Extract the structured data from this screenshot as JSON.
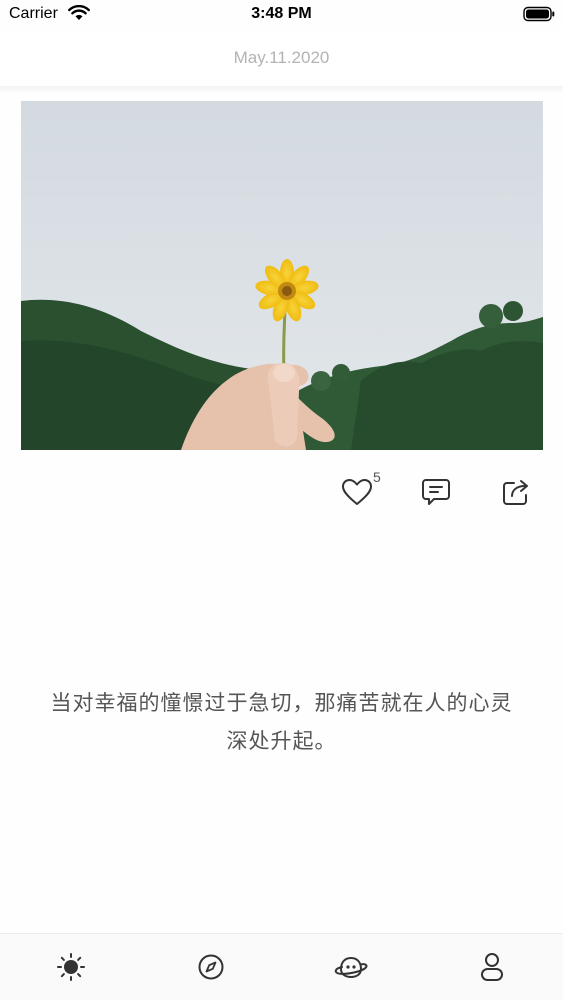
{
  "status_bar": {
    "carrier": "Carrier",
    "time": "3:48 PM",
    "icons": [
      "wifi-icon",
      "battery-icon"
    ]
  },
  "header": {
    "date": "May.11.2020"
  },
  "post": {
    "image": {
      "subject": "hand-holding-yellow-flower"
    },
    "actions": {
      "like_count": "5",
      "icons": [
        "heart-icon",
        "comment-icon",
        "share-icon"
      ]
    },
    "quote_line1": "当对幸福的憧憬过于急切，那痛苦就在人的心灵",
    "quote_line2": "深处升起。"
  },
  "tab_bar": {
    "tabs": [
      {
        "icon": "sun-icon"
      },
      {
        "icon": "compass-icon"
      },
      {
        "icon": "planet-icon"
      },
      {
        "icon": "profile-icon"
      }
    ]
  },
  "colors": {
    "date_text": "#b3b3b3",
    "quote_text": "#555555",
    "icon": "#333333",
    "flower": "#f2c218",
    "hills": "#2e5a35",
    "sky": "#d6dde2"
  }
}
